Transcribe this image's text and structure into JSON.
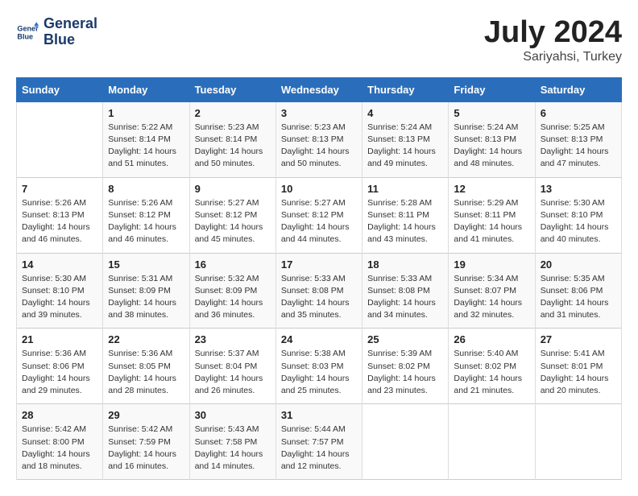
{
  "header": {
    "logo_line1": "General",
    "logo_line2": "Blue",
    "month": "July 2024",
    "location": "Sariyahsi, Turkey"
  },
  "calendar": {
    "days_of_week": [
      "Sunday",
      "Monday",
      "Tuesday",
      "Wednesday",
      "Thursday",
      "Friday",
      "Saturday"
    ],
    "weeks": [
      [
        {
          "day": "",
          "info": ""
        },
        {
          "day": "1",
          "info": "Sunrise: 5:22 AM\nSunset: 8:14 PM\nDaylight: 14 hours\nand 51 minutes."
        },
        {
          "day": "2",
          "info": "Sunrise: 5:23 AM\nSunset: 8:14 PM\nDaylight: 14 hours\nand 50 minutes."
        },
        {
          "day": "3",
          "info": "Sunrise: 5:23 AM\nSunset: 8:13 PM\nDaylight: 14 hours\nand 50 minutes."
        },
        {
          "day": "4",
          "info": "Sunrise: 5:24 AM\nSunset: 8:13 PM\nDaylight: 14 hours\nand 49 minutes."
        },
        {
          "day": "5",
          "info": "Sunrise: 5:24 AM\nSunset: 8:13 PM\nDaylight: 14 hours\nand 48 minutes."
        },
        {
          "day": "6",
          "info": "Sunrise: 5:25 AM\nSunset: 8:13 PM\nDaylight: 14 hours\nand 47 minutes."
        }
      ],
      [
        {
          "day": "7",
          "info": "Sunrise: 5:26 AM\nSunset: 8:13 PM\nDaylight: 14 hours\nand 46 minutes."
        },
        {
          "day": "8",
          "info": "Sunrise: 5:26 AM\nSunset: 8:12 PM\nDaylight: 14 hours\nand 46 minutes."
        },
        {
          "day": "9",
          "info": "Sunrise: 5:27 AM\nSunset: 8:12 PM\nDaylight: 14 hours\nand 45 minutes."
        },
        {
          "day": "10",
          "info": "Sunrise: 5:27 AM\nSunset: 8:12 PM\nDaylight: 14 hours\nand 44 minutes."
        },
        {
          "day": "11",
          "info": "Sunrise: 5:28 AM\nSunset: 8:11 PM\nDaylight: 14 hours\nand 43 minutes."
        },
        {
          "day": "12",
          "info": "Sunrise: 5:29 AM\nSunset: 8:11 PM\nDaylight: 14 hours\nand 41 minutes."
        },
        {
          "day": "13",
          "info": "Sunrise: 5:30 AM\nSunset: 8:10 PM\nDaylight: 14 hours\nand 40 minutes."
        }
      ],
      [
        {
          "day": "14",
          "info": "Sunrise: 5:30 AM\nSunset: 8:10 PM\nDaylight: 14 hours\nand 39 minutes."
        },
        {
          "day": "15",
          "info": "Sunrise: 5:31 AM\nSunset: 8:09 PM\nDaylight: 14 hours\nand 38 minutes."
        },
        {
          "day": "16",
          "info": "Sunrise: 5:32 AM\nSunset: 8:09 PM\nDaylight: 14 hours\nand 36 minutes."
        },
        {
          "day": "17",
          "info": "Sunrise: 5:33 AM\nSunset: 8:08 PM\nDaylight: 14 hours\nand 35 minutes."
        },
        {
          "day": "18",
          "info": "Sunrise: 5:33 AM\nSunset: 8:08 PM\nDaylight: 14 hours\nand 34 minutes."
        },
        {
          "day": "19",
          "info": "Sunrise: 5:34 AM\nSunset: 8:07 PM\nDaylight: 14 hours\nand 32 minutes."
        },
        {
          "day": "20",
          "info": "Sunrise: 5:35 AM\nSunset: 8:06 PM\nDaylight: 14 hours\nand 31 minutes."
        }
      ],
      [
        {
          "day": "21",
          "info": "Sunrise: 5:36 AM\nSunset: 8:06 PM\nDaylight: 14 hours\nand 29 minutes."
        },
        {
          "day": "22",
          "info": "Sunrise: 5:36 AM\nSunset: 8:05 PM\nDaylight: 14 hours\nand 28 minutes."
        },
        {
          "day": "23",
          "info": "Sunrise: 5:37 AM\nSunset: 8:04 PM\nDaylight: 14 hours\nand 26 minutes."
        },
        {
          "day": "24",
          "info": "Sunrise: 5:38 AM\nSunset: 8:03 PM\nDaylight: 14 hours\nand 25 minutes."
        },
        {
          "day": "25",
          "info": "Sunrise: 5:39 AM\nSunset: 8:02 PM\nDaylight: 14 hours\nand 23 minutes."
        },
        {
          "day": "26",
          "info": "Sunrise: 5:40 AM\nSunset: 8:02 PM\nDaylight: 14 hours\nand 21 minutes."
        },
        {
          "day": "27",
          "info": "Sunrise: 5:41 AM\nSunset: 8:01 PM\nDaylight: 14 hours\nand 20 minutes."
        }
      ],
      [
        {
          "day": "28",
          "info": "Sunrise: 5:42 AM\nSunset: 8:00 PM\nDaylight: 14 hours\nand 18 minutes."
        },
        {
          "day": "29",
          "info": "Sunrise: 5:42 AM\nSunset: 7:59 PM\nDaylight: 14 hours\nand 16 minutes."
        },
        {
          "day": "30",
          "info": "Sunrise: 5:43 AM\nSunset: 7:58 PM\nDaylight: 14 hours\nand 14 minutes."
        },
        {
          "day": "31",
          "info": "Sunrise: 5:44 AM\nSunset: 7:57 PM\nDaylight: 14 hours\nand 12 minutes."
        },
        {
          "day": "",
          "info": ""
        },
        {
          "day": "",
          "info": ""
        },
        {
          "day": "",
          "info": ""
        }
      ]
    ]
  }
}
